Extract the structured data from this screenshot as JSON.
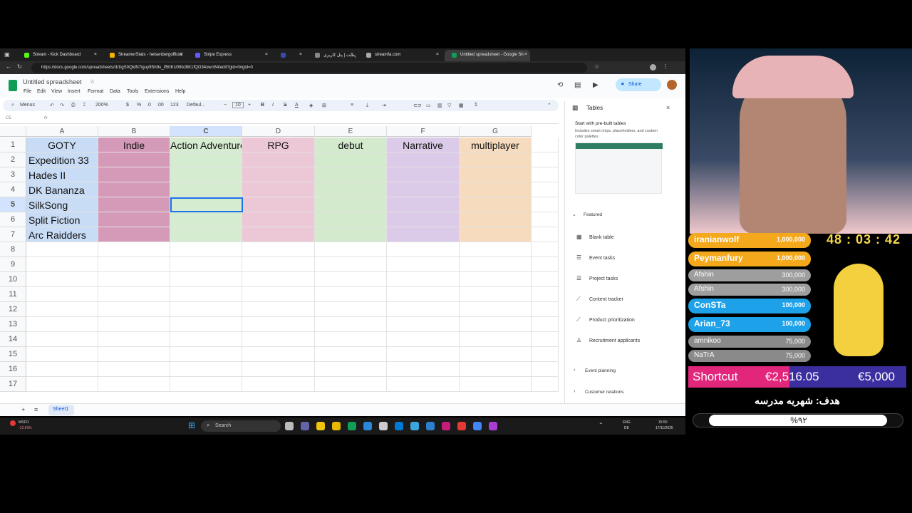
{
  "browser": {
    "tabs": [
      {
        "label": "Stream - Kick Dashboard",
        "color": "#53fc18"
      },
      {
        "label": "StreamerStats - heisenbergofficial",
        "color": "#f4b400"
      },
      {
        "label": "Stripe Express",
        "color": "#635bff"
      },
      {
        "label": "",
        "color": "#3949ab"
      },
      {
        "label": "ریست | پنل کاربری",
        "color": "#888888"
      },
      {
        "label": "streamfa.com",
        "color": "#aaaaaa"
      },
      {
        "label": "Untitled spreadsheet - Google Sh",
        "color": "#0f9d58"
      }
    ],
    "url": "https://docs.google.com/spreadsheets/d/1lgS0QldN7iguy9Sh9u_if50KU09bJ8K1fQO34xwrr84/edit?gid=0#gid=0"
  },
  "sheets": {
    "title": "Untitled spreadsheet",
    "menu": [
      "File",
      "Edit",
      "View",
      "Insert",
      "Format",
      "Data",
      "Tools",
      "Extensions",
      "Help"
    ],
    "share_label": "Share",
    "toolbar": {
      "menus": "Menus",
      "zoom": "200%",
      "currency": "$",
      "percent": "%",
      "dec1": ".0",
      "dec2": ".00",
      "numfmt": "123",
      "font": "Defaul...",
      "size": "10",
      "bold": "B",
      "italic": "I",
      "strike": "S",
      "color": "A"
    },
    "cell_ref": "C5",
    "fx": "fx",
    "columns": [
      "A",
      "B",
      "C",
      "D",
      "E",
      "F",
      "G"
    ],
    "rows": [
      "1",
      "2",
      "3",
      "4",
      "5",
      "6",
      "7",
      "8",
      "9",
      "10",
      "11",
      "12",
      "13",
      "14",
      "15",
      "16",
      "17"
    ],
    "header_row": [
      "GOTY",
      "Indie",
      "Action Adventure",
      "RPG",
      "debut",
      "Narrative",
      "multiplayer"
    ],
    "games": [
      "Expedition 33",
      "Hades II",
      "DK Bananza",
      "SilkSong",
      "Split Fiction",
      "Arc Raidders"
    ],
    "column_colors": [
      "#c9dcf5",
      "#d59ab8",
      "#d5ecd0",
      "#ecc8d6",
      "#d3eacd",
      "#dbcbe8",
      "#f6dbbf"
    ],
    "sheet_tab": "Sheet1"
  },
  "tables_panel": {
    "title": "Tables",
    "intro_title": "Start with pre-built tables",
    "intro_desc": "Includes smart chips, placeholders, and custom color palettes",
    "featured": "Featured",
    "items": [
      "Blank table",
      "Event tasks",
      "Project tasks",
      "Content tracker",
      "Product prioritization",
      "Recruitment applicants"
    ],
    "sections": [
      "Event planning",
      "Customer relations"
    ]
  },
  "taskbar": {
    "ticker": "MSFO",
    "ticker_change": "-12,63%",
    "search": "Search",
    "lang": "ENG",
    "lang2": "DE",
    "time": "15:50",
    "date": "17/11/2025"
  },
  "overlay": {
    "timer": "48 : 03 : 42",
    "donors": [
      {
        "name": "iranianwolf",
        "amount": "1,000,000",
        "color": "#f4a81c"
      },
      {
        "name": "Peymanfury",
        "amount": "1,000,000",
        "color": "#f4a81c"
      },
      {
        "name": "Afshin",
        "amount": "300,000",
        "color": "#9e9e9e"
      },
      {
        "name": "Afshin",
        "amount": "300,000",
        "color": "#9e9e9e"
      },
      {
        "name": "ConSTa",
        "amount": "100,000",
        "color": "#1da1e8"
      },
      {
        "name": "Arian_73",
        "amount": "100,000",
        "color": "#1da1e8"
      },
      {
        "name": "amnikoo",
        "amount": "75,000",
        "color": "#8a8a8a"
      },
      {
        "name": "NaTrA",
        "amount": "75,000",
        "color": "#8a8a8a"
      }
    ],
    "goal_label": "Shortcut",
    "goal_current": "€2,516.05",
    "goal_target": "€5,000",
    "goal_title": "هدف: شهریه مدرسه",
    "goal_percent": "%۹۲",
    "goal_progress": 0.92
  }
}
